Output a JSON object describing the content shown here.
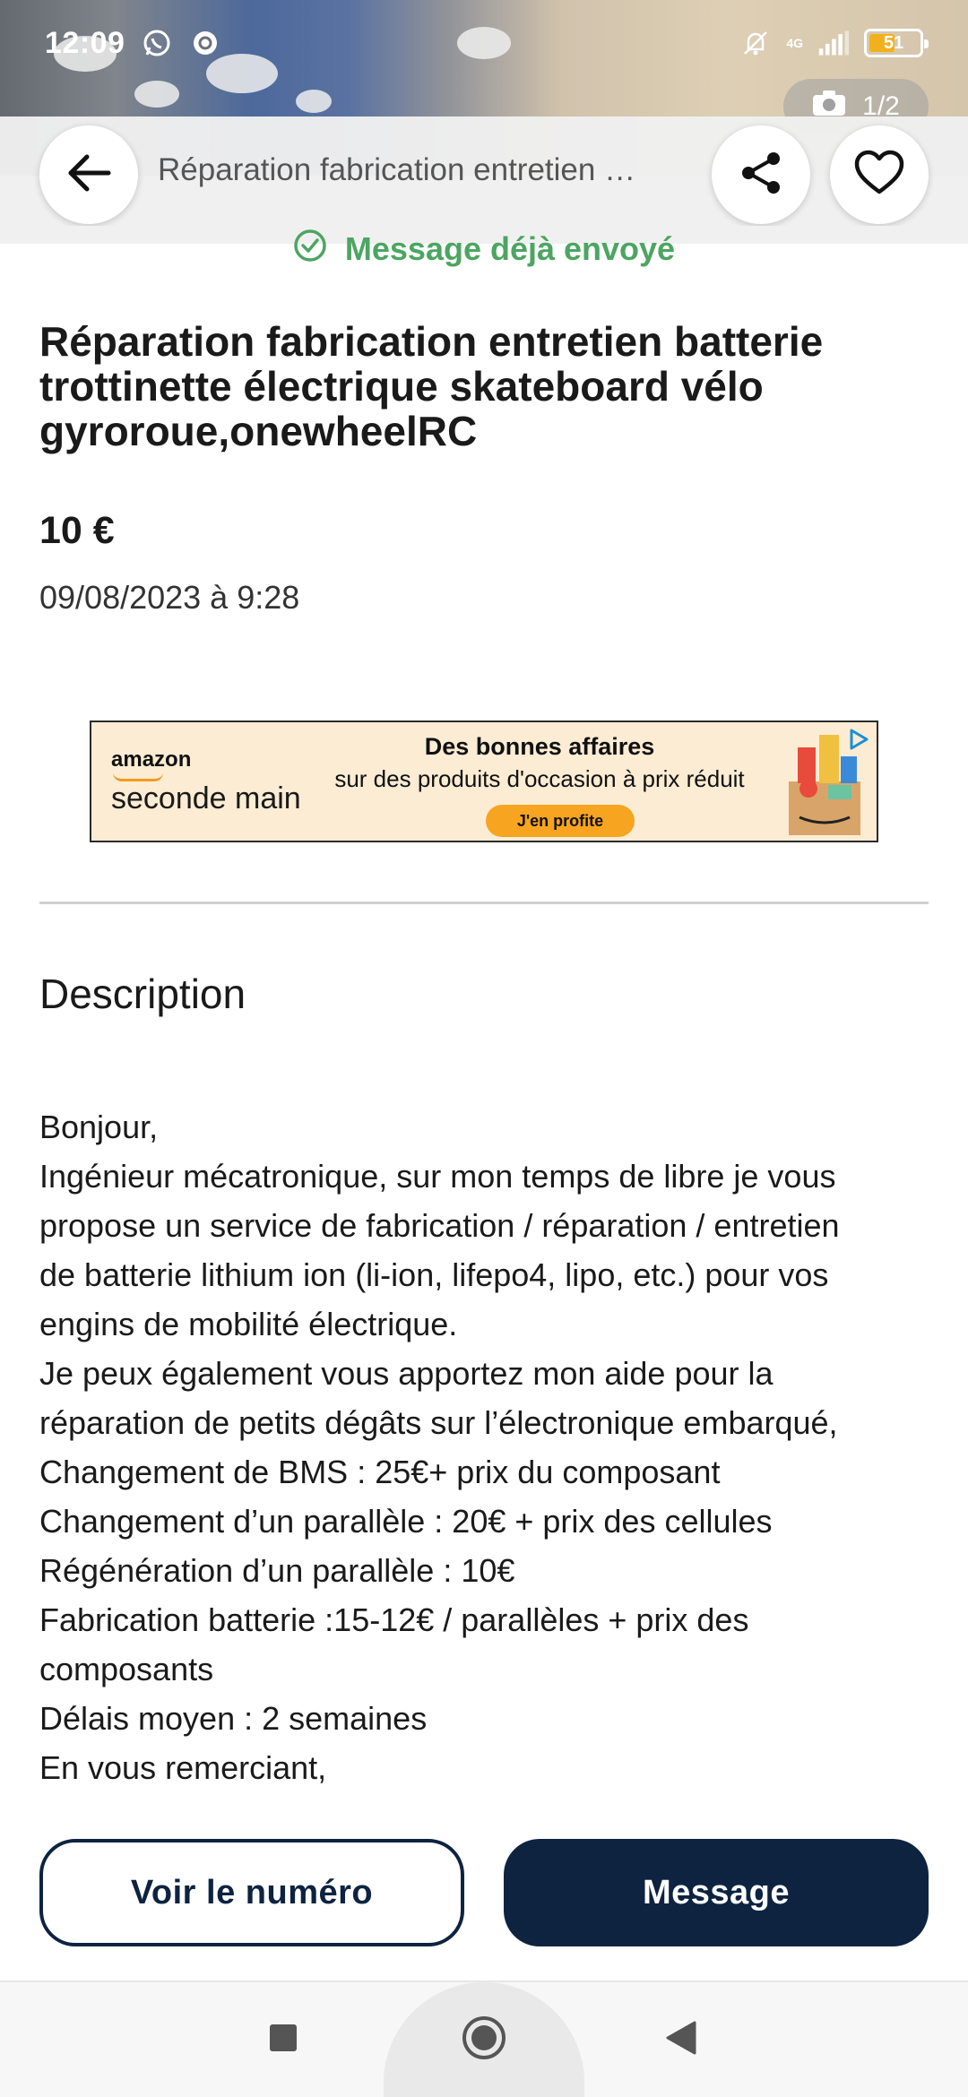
{
  "status_bar": {
    "time": "12:09",
    "network": "4G",
    "battery": "51",
    "battery_level": 0.51,
    "icons": [
      "whatsapp-icon",
      "sync-icon",
      "mute-bell-icon",
      "signal-icon",
      "battery-icon"
    ]
  },
  "gallery": {
    "counter": "1/2",
    "icon": "camera-icon"
  },
  "header": {
    "title": "Réparation fabrication entretien …",
    "back_icon": "arrow-left-icon",
    "share_icon": "share-icon",
    "favorite_icon": "heart-icon"
  },
  "message_status": {
    "text": "Message déjà envoyé",
    "color": "#4ca561"
  },
  "listing": {
    "title_lines": [
      "Réparation fabrication entretien batterie",
      "trottinette électrique skateboard vélo",
      "gyroroue,onewheelRC"
    ],
    "price": "10 €",
    "date": "09/08/2023 à 9:28"
  },
  "ad": {
    "brand": "amazon",
    "brand_sub": "seconde main",
    "headline": "Des bonnes affaires",
    "text": "sur des produits d'occasion à prix réduit",
    "cta": "J'en profite"
  },
  "description": {
    "heading": "Description",
    "lines": [
      "Bonjour,",
      "Ingénieur mécatronique, sur mon temps de libre je vous",
      "propose un service de fabrication / réparation / entretien",
      "de batterie lithium ion (li-ion, lifepo4, lipo, etc.) pour vos",
      "engins de mobilité électrique.",
      "Je peux également vous apportez mon aide pour la",
      "réparation de petits dégâts sur l’électronique embarqué,",
      "Changement de BMS : 25€+ prix du composant",
      "Changement d’un parallèle : 20€ + prix des cellules",
      "Régénération d’un parallèle : 10€",
      "Fabrication batterie :15-12€ / parallèles + prix des",
      "composants",
      "Délais moyen : 2 semaines",
      "En vous remerciant,"
    ]
  },
  "actions": {
    "phone_button": "Voir le numéro",
    "message_button": "Message",
    "primary_color": "#0d2340"
  },
  "nav": {
    "recents_icon": "square-icon",
    "home_icon": "circle-icon",
    "back_icon": "triangle-back-icon"
  }
}
